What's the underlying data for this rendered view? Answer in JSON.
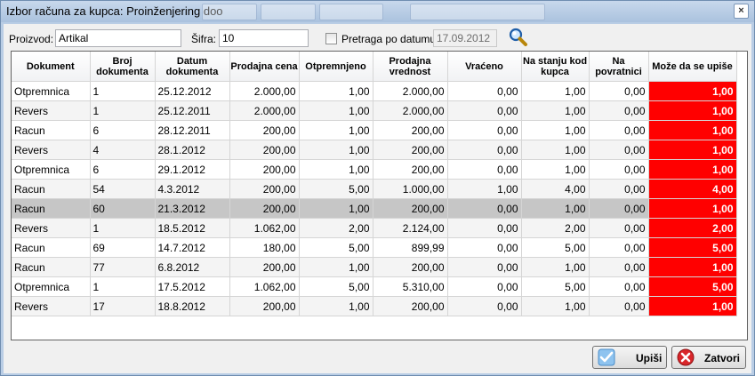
{
  "window": {
    "title": "Izbor računa za kupca: Proinženjering doo",
    "close_glyph": "×"
  },
  "filter": {
    "proizvod_label": "Proizvod:",
    "proizvod_value": "Artikal",
    "sifra_label": "Šifra:",
    "sifra_value": "10",
    "pretraga_label": "Pretraga po datumu:",
    "pretraga_checked": false,
    "date_value": "17.09.2012",
    "search_icon": "magnifier-icon"
  },
  "table": {
    "columns": [
      "Dokument",
      "Broj dokumenta",
      "Datum dokumenta",
      "Prodajna cena",
      "Otpremnjeno",
      "Prodajna vrednost",
      "Vraćeno",
      "Na stanju kod kupca",
      "Na povratnici",
      "Može da se upiše"
    ],
    "rows": [
      [
        "Otpremnica",
        "1",
        "25.12.2012",
        "2.000,00",
        "1,00",
        "2.000,00",
        "0,00",
        "1,00",
        "0,00",
        "1,00"
      ],
      [
        "Revers",
        "1",
        "25.12.2011",
        "2.000,00",
        "1,00",
        "2.000,00",
        "0,00",
        "1,00",
        "0,00",
        "1,00"
      ],
      [
        "Racun",
        "6",
        "28.12.2011",
        "200,00",
        "1,00",
        "200,00",
        "0,00",
        "1,00",
        "0,00",
        "1,00"
      ],
      [
        "Revers",
        "4",
        "28.1.2012",
        "200,00",
        "1,00",
        "200,00",
        "0,00",
        "1,00",
        "0,00",
        "1,00"
      ],
      [
        "Otpremnica",
        "6",
        "29.1.2012",
        "200,00",
        "1,00",
        "200,00",
        "0,00",
        "1,00",
        "0,00",
        "1,00"
      ],
      [
        "Racun",
        "54",
        "4.3.2012",
        "200,00",
        "5,00",
        "1.000,00",
        "1,00",
        "4,00",
        "0,00",
        "4,00"
      ],
      [
        "Racun",
        "60",
        "21.3.2012",
        "200,00",
        "1,00",
        "200,00",
        "0,00",
        "1,00",
        "0,00",
        "1,00"
      ],
      [
        "Revers",
        "1",
        "18.5.2012",
        "1.062,00",
        "2,00",
        "2.124,00",
        "0,00",
        "2,00",
        "0,00",
        "2,00"
      ],
      [
        "Racun",
        "69",
        "14.7.2012",
        "180,00",
        "5,00",
        "899,99",
        "0,00",
        "5,00",
        "0,00",
        "5,00"
      ],
      [
        "Racun",
        "77",
        "6.8.2012",
        "200,00",
        "1,00",
        "200,00",
        "0,00",
        "1,00",
        "0,00",
        "1,00"
      ],
      [
        "Otpremnica",
        "1",
        "17.5.2012",
        "1.062,00",
        "5,00",
        "5.310,00",
        "0,00",
        "5,00",
        "0,00",
        "5,00"
      ],
      [
        "Revers",
        "17",
        "18.8.2012",
        "200,00",
        "1,00",
        "200,00",
        "0,00",
        "1,00",
        "0,00",
        "1,00"
      ]
    ],
    "selected_row": 6,
    "highlight_color": "#ff0000"
  },
  "buttons": {
    "upisi_label": "Upiši",
    "upisi_icon": "checkmark-icon",
    "zatvori_label": "Zatvori",
    "zatvori_icon": "cancel-icon"
  }
}
